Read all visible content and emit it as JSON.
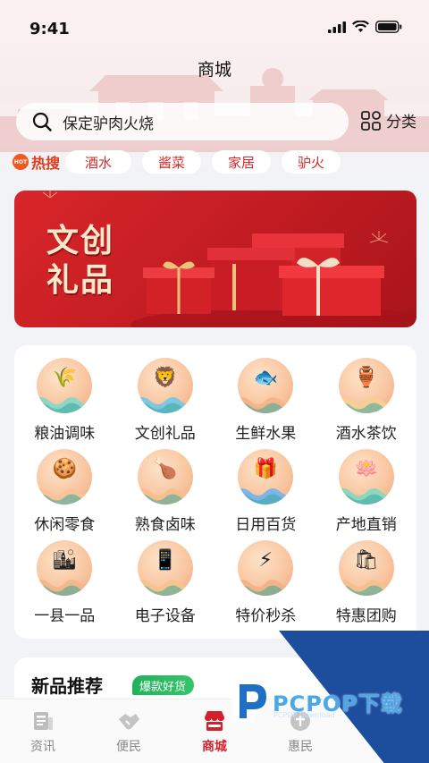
{
  "status": {
    "time": "9:41"
  },
  "header": {
    "title": "商城"
  },
  "search": {
    "placeholder": "保定驴肉火烧",
    "category_label": "分类"
  },
  "hot": {
    "badge": "HOT",
    "label": "热搜",
    "tags": [
      "酒水",
      "酱菜",
      "家居",
      "驴火"
    ]
  },
  "banner": {
    "line1": "文创",
    "line2": "礼品"
  },
  "categories": [
    {
      "label": "粮油调味",
      "icon": "grain-oil-icon"
    },
    {
      "label": "文创礼品",
      "icon": "lion-gift-icon"
    },
    {
      "label": "生鲜水果",
      "icon": "fish-icon"
    },
    {
      "label": "酒水茶饮",
      "icon": "wine-jar-icon"
    },
    {
      "label": "休闲零食",
      "icon": "snack-icon"
    },
    {
      "label": "熟食卤味",
      "icon": "cooked-food-icon"
    },
    {
      "label": "日用百货",
      "icon": "gift-box-icon"
    },
    {
      "label": "产地直销",
      "icon": "lotus-icon"
    },
    {
      "label": "一县一品",
      "icon": "skyline-icon"
    },
    {
      "label": "电子设备",
      "icon": "phone-icon"
    },
    {
      "label": "特价秒杀",
      "icon": "lightning-icon"
    },
    {
      "label": "特惠团购",
      "icon": "shopping-bag-icon"
    }
  ],
  "new_section": {
    "title": "新品推荐",
    "badge": "爆款好货"
  },
  "tabs": [
    {
      "label": "资讯",
      "active": false
    },
    {
      "label": "便民",
      "active": false
    },
    {
      "label": "商城",
      "active": true
    },
    {
      "label": "惠民",
      "active": false
    },
    {
      "label": "",
      "active": false
    }
  ],
  "watermark": {
    "brand": "PCPOP下载",
    "sub": "PCPOP Download"
  },
  "colors": {
    "accent": "#d3202a",
    "hot": "#e23a1c",
    "badge_green": "#21b35a"
  }
}
